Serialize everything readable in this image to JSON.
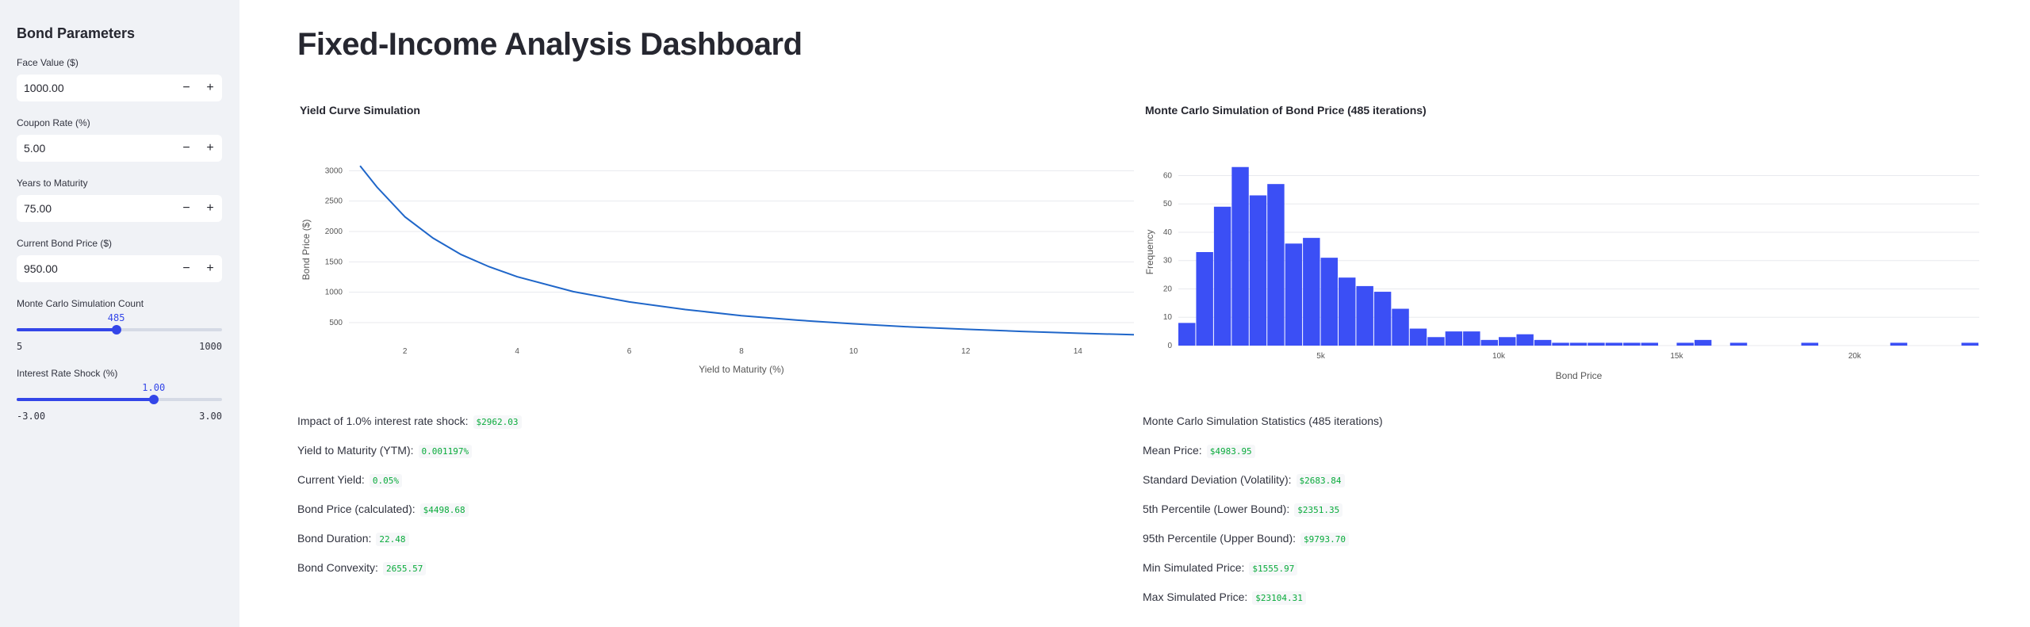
{
  "sidebar": {
    "title": "Bond Parameters",
    "inputs": [
      {
        "label": "Face Value ($)",
        "value": "1000.00"
      },
      {
        "label": "Coupon Rate (%)",
        "value": "5.00"
      },
      {
        "label": "Years to Maturity",
        "value": "75.00"
      },
      {
        "label": "Current Bond Price ($)",
        "value": "950.00"
      }
    ],
    "minus": "−",
    "plus": "+",
    "sliders": [
      {
        "label": "Monte Carlo Simulation Count",
        "value": "485",
        "min": "5",
        "max": "1000",
        "fraction": 0.485
      },
      {
        "label": "Interest Rate Shock (%)",
        "value": "1.00",
        "min": "-3.00",
        "max": "3.00",
        "fraction": 0.667
      }
    ]
  },
  "main": {
    "title": "Fixed-Income Analysis Dashboard",
    "yield_chart_title": "Yield Curve Simulation",
    "mc_chart_title": "Monte Carlo Simulation of Bond Price (485 iterations)",
    "left_metrics": [
      {
        "label": "Impact of 1.0% interest rate shock:",
        "value": "$2962.03"
      },
      {
        "label": "Yield to Maturity (YTM):",
        "value": "0.001197%"
      },
      {
        "label": "Current Yield:",
        "value": "0.05%"
      },
      {
        "label": "Bond Price (calculated):",
        "value": "$4498.68"
      },
      {
        "label": "Bond Duration:",
        "value": "22.48"
      },
      {
        "label": "Bond Convexity:",
        "value": "2655.57"
      }
    ],
    "right_heading": "Monte Carlo Simulation Statistics (485 iterations)",
    "right_metrics": [
      {
        "label": "Mean Price:",
        "value": "$4983.95"
      },
      {
        "label": "Standard Deviation (Volatility):",
        "value": "$2683.84"
      },
      {
        "label": "5th Percentile (Lower Bound):",
        "value": "$2351.35"
      },
      {
        "label": "95th Percentile (Upper Bound):",
        "value": "$9793.70"
      },
      {
        "label": "Min Simulated Price:",
        "value": "$1555.97"
      },
      {
        "label": "Max Simulated Price:",
        "value": "$23104.31"
      }
    ]
  },
  "chart_data": [
    {
      "type": "line",
      "title": "Yield Curve Simulation",
      "xlabel": "Yield to Maturity (%)",
      "ylabel": "Bond Price ($)",
      "xlim": [
        1,
        15
      ],
      "ylim": [
        200,
        3200
      ],
      "xticks": [
        2,
        4,
        6,
        8,
        10,
        12,
        14
      ],
      "yticks": [
        500,
        1000,
        1500,
        2000,
        2500,
        3000
      ],
      "color": "#1f66c9",
      "series": [
        {
          "x": [
            1.2,
            1.5,
            2,
            2.5,
            3,
            3.5,
            4,
            5,
            6,
            7,
            8,
            9,
            10,
            11,
            12,
            13,
            14,
            15
          ],
          "values": [
            3080,
            2730,
            2240,
            1890,
            1620,
            1420,
            1255,
            1010,
            840,
            715,
            615,
            540,
            480,
            430,
            390,
            355,
            325,
            300
          ]
        }
      ]
    },
    {
      "type": "bar",
      "title": "Monte Carlo Simulation of Bond Price (485 iterations)",
      "xlabel": "Bond Price",
      "ylabel": "Frequency",
      "xlim": [
        1000,
        23500
      ],
      "ylim": [
        0,
        66
      ],
      "bin_width": 500,
      "xticks": [
        {
          "value": 5000,
          "label": "5k"
        },
        {
          "value": 10000,
          "label": "10k"
        },
        {
          "value": 15000,
          "label": "15k"
        },
        {
          "value": 20000,
          "label": "20k"
        }
      ],
      "yticks": [
        0,
        10,
        20,
        30,
        40,
        50,
        60
      ],
      "color": "#3b4ff5",
      "bins": [
        {
          "x": 1000,
          "y": 8
        },
        {
          "x": 1500,
          "y": 33
        },
        {
          "x": 2000,
          "y": 49
        },
        {
          "x": 2500,
          "y": 63
        },
        {
          "x": 3000,
          "y": 53
        },
        {
          "x": 3500,
          "y": 57
        },
        {
          "x": 4000,
          "y": 36
        },
        {
          "x": 4500,
          "y": 38
        },
        {
          "x": 5000,
          "y": 31
        },
        {
          "x": 5500,
          "y": 24
        },
        {
          "x": 6000,
          "y": 21
        },
        {
          "x": 6500,
          "y": 19
        },
        {
          "x": 7000,
          "y": 13
        },
        {
          "x": 7500,
          "y": 6
        },
        {
          "x": 8000,
          "y": 3
        },
        {
          "x": 8500,
          "y": 5
        },
        {
          "x": 9000,
          "y": 5
        },
        {
          "x": 9500,
          "y": 2
        },
        {
          "x": 10000,
          "y": 3
        },
        {
          "x": 10500,
          "y": 4
        },
        {
          "x": 11000,
          "y": 2
        },
        {
          "x": 11500,
          "y": 1
        },
        {
          "x": 12000,
          "y": 1
        },
        {
          "x": 12500,
          "y": 1
        },
        {
          "x": 13000,
          "y": 1
        },
        {
          "x": 13500,
          "y": 1
        },
        {
          "x": 14000,
          "y": 1
        },
        {
          "x": 15000,
          "y": 1
        },
        {
          "x": 15500,
          "y": 2
        },
        {
          "x": 16500,
          "y": 1
        },
        {
          "x": 18500,
          "y": 1
        },
        {
          "x": 21000,
          "y": 1
        },
        {
          "x": 23000,
          "y": 1
        }
      ]
    }
  ]
}
